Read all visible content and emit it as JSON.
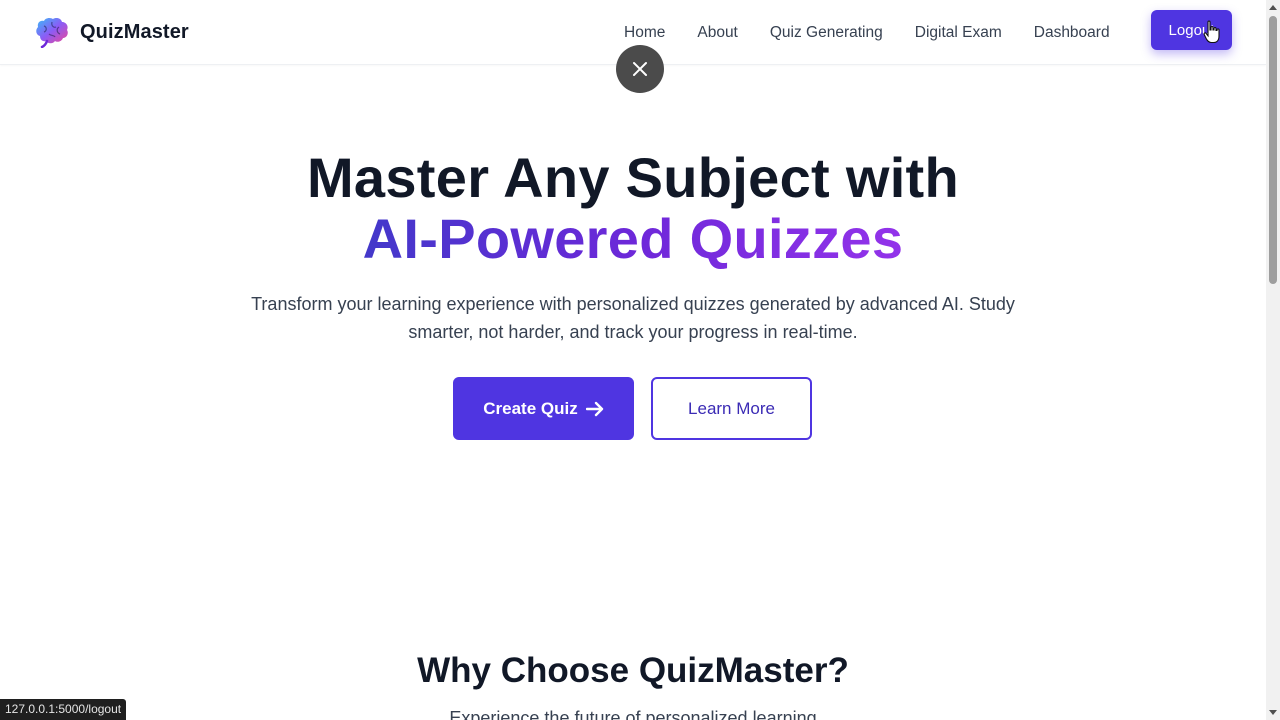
{
  "header": {
    "brand_name": "QuizMaster",
    "logo_icon": "brain-icon",
    "nav": [
      {
        "label": "Home"
      },
      {
        "label": "About"
      },
      {
        "label": "Quiz Generating"
      },
      {
        "label": "Digital Exam"
      },
      {
        "label": "Dashboard"
      }
    ],
    "logout_label": "Logout"
  },
  "overlay": {
    "close_icon": "close-icon"
  },
  "hero": {
    "title_line1": "Master Any Subject with",
    "title_line2": "AI-Powered Quizzes",
    "subtitle": "Transform your learning experience with personalized quizzes generated by advanced AI. Study smarter, not harder, and track your progress in real-time.",
    "primary_cta": "Create Quiz",
    "primary_cta_icon": "arrow-right-icon",
    "secondary_cta": "Learn More"
  },
  "features": {
    "title": "Why Choose QuizMaster?",
    "subtitle": "Experience the future of personalized learning"
  },
  "status_bar": {
    "url": "127.0.0.1:5000/logout"
  },
  "colors": {
    "brand_primary": "#4f35e1",
    "gradient_start": "#4338ca",
    "gradient_end": "#9333ea",
    "text_dark": "#111827",
    "text_muted": "#374151"
  }
}
